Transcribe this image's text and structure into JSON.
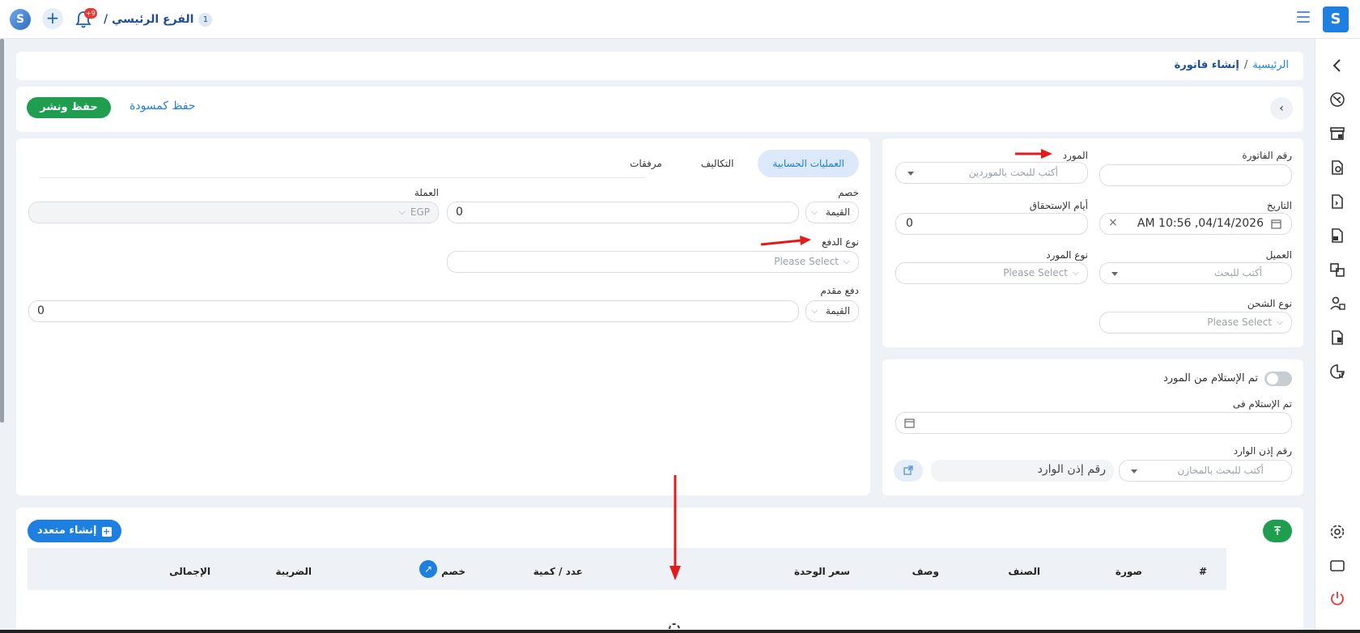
{
  "topbar": {
    "branch_label": "الفرع الرئيسي /",
    "branch_number": "1",
    "notification_count": "+9",
    "brand_letter": "S"
  },
  "breadcrumb": {
    "home": "الرئيسية",
    "separator": "/",
    "current": "إنشاء فاتورة"
  },
  "actions": {
    "publish_label": "حفظ ونشر",
    "draft_label": "حفظ كمسودة"
  },
  "invoice_form": {
    "invoice_number_label": "رقم الفاتورة",
    "invoice_number_value": "",
    "supplier_label": "المورد",
    "supplier_placeholder": "أكتب للبحث بالموردين",
    "date_label": "التاريخ",
    "date_value": "04/14/2026, 10:56 AM",
    "due_days_label": "أيام الإستحقاق",
    "due_days_value": "0",
    "client_label": "العميل",
    "client_placeholder": "أكتب للبحث",
    "supplier_type_label": "نوع المورد",
    "supplier_type_placeholder": "Please Select",
    "shipping_type_label": "نوع الشحن",
    "shipping_type_placeholder": "Please Select"
  },
  "receiving": {
    "received_toggle_label": "تم الإستلام من المورد",
    "received_toggle_on": false,
    "received_in_label": "تم الإستلام فى",
    "receipt_number_label": "رقم إذن الوارد",
    "warehouse_placeholder": "أكتب للبحث بالمخازن",
    "receipt_number_placeholder": "رقم إذن الوارد"
  },
  "tabs": [
    {
      "label": "العمليات الحسابية",
      "active": true
    },
    {
      "label": "التكاليف",
      "active": false
    },
    {
      "label": "مرفقات",
      "active": false
    }
  ],
  "accounting": {
    "discount_label": "خصم",
    "discount_type": "القيمة",
    "discount_value": "0",
    "currency_label": "العملة",
    "currency_value": "EGP",
    "payment_type_label": "نوع الدفع",
    "payment_type_placeholder": "Please Select",
    "advance_payment_label": "دفع مقدم",
    "advance_type": "القيمة",
    "advance_value": "0"
  },
  "items_table": {
    "create_multiple_label": "إنشاء متعدد",
    "columns": {
      "index": "#",
      "image": "صورة",
      "item": "الصنف",
      "description": "وصف",
      "unit_price": "سعر الوحدة",
      "quantity": "عدد / كمية",
      "discount": "خصم",
      "tax": "الضريبة",
      "total": "الإجمالى"
    }
  },
  "colors": {
    "primary": "#1d7fe0",
    "success": "#1e9e4e",
    "annotation_arrow": "#e31b1b"
  }
}
